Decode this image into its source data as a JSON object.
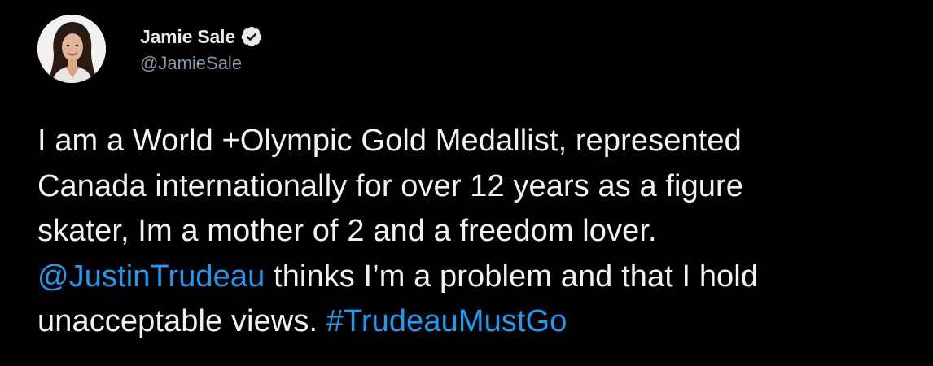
{
  "author": {
    "display_name": "Jamie Sale",
    "handle": "@JamieSale",
    "verified": true,
    "avatar_icon": "profile-photo"
  },
  "tweet": {
    "line1": "I am a World +Olympic Gold Medallist, represented",
    "line2": "Canada internationally for over 12 years as a figure",
    "line3": "skater, Im a mother of 2 and a freedom lover.",
    "mention": "@JustinTrudeau",
    "line4_rest": " thinks I’m a problem and that I hold",
    "line5_start": "unacceptable views. ",
    "hashtag": "#TrudeauMustGo"
  },
  "colors": {
    "background": "#000000",
    "text": "#e7e9ea",
    "secondary": "#8b98a5",
    "link": "#1d9bf0",
    "verified_badge": "#e7e9ea"
  }
}
